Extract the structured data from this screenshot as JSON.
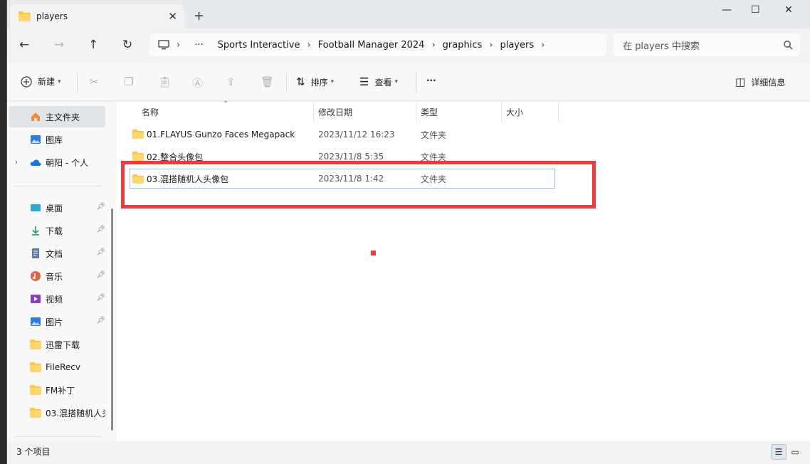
{
  "tab": {
    "title": "players",
    "close": "✕",
    "new": "+"
  },
  "window": {
    "minimize": "—",
    "maximize": "☐",
    "close": "✕"
  },
  "nav": {
    "back": "←",
    "forward": "→",
    "up": "↑",
    "refresh": "↻"
  },
  "address": {
    "more": "···",
    "segments": [
      "Sports Interactive",
      "Football Manager 2024",
      "graphics",
      "players"
    ],
    "separator": "›"
  },
  "search": {
    "placeholder": "在 players 中搜索",
    "icon": "search-icon"
  },
  "toolbar": {
    "new_label": "新建",
    "sort_label": "排序",
    "view_label": "查看",
    "more": "···",
    "details_label": "详细信息"
  },
  "sidebar": {
    "items": [
      {
        "label": "主文件夹",
        "icon": "home-icon"
      },
      {
        "label": "图库",
        "icon": "gallery-icon"
      },
      {
        "label": "朝阳 - 个人",
        "icon": "cloud-icon"
      },
      {
        "label": "桌面",
        "icon": "desktop-icon"
      },
      {
        "label": "下载",
        "icon": "download-icon"
      },
      {
        "label": "文档",
        "icon": "document-icon"
      },
      {
        "label": "音乐",
        "icon": "music-icon"
      },
      {
        "label": "视频",
        "icon": "video-icon"
      },
      {
        "label": "图片",
        "icon": "picture-icon"
      },
      {
        "label": "迅雷下载",
        "icon": "folder-icon"
      },
      {
        "label": "FileRecv",
        "icon": "folder-icon"
      },
      {
        "label": "FM补丁",
        "icon": "folder-icon"
      },
      {
        "label": "03.混搭随机人头",
        "icon": "folder-icon"
      }
    ]
  },
  "columns": {
    "name": "名称",
    "modified": "修改日期",
    "type": "类型",
    "size": "大小"
  },
  "files": [
    {
      "name": "01.FLAYUS Gunzo Faces Megapack",
      "modified": "2023/11/12 16:23",
      "type": "文件夹"
    },
    {
      "name": "02.整合头像包",
      "modified": "2023/11/8 5:35",
      "type": "文件夹"
    },
    {
      "name": "03.混搭随机人头像包",
      "modified": "2023/11/8 1:42",
      "type": "文件夹"
    }
  ],
  "status": {
    "count": "3 个项目"
  },
  "colors": {
    "accent": "#0067c0",
    "highlight": "#ef3b3b",
    "folder": "#f8c64a"
  }
}
